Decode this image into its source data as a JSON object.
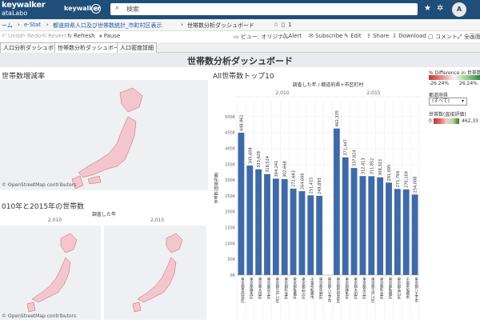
{
  "topnav": {
    "logo_line1": "keywalker",
    "logo_line2": "ataLabo",
    "site_name": "keywalker",
    "search_icon": "search-icon",
    "search_placeholder": "検索",
    "icons": [
      "alert-icon",
      "star-icon",
      "settings-icon"
    ],
    "avatar_initials": "A"
  },
  "breadcrumb": {
    "items": [
      "ーム",
      "e-Stat",
      "都道府県人口及び世帯数統計_市町村区表示",
      "世帯数分析ダッシュボード"
    ],
    "separator": "›",
    "version": "1"
  },
  "toolbar": {
    "left": [
      "Undo",
      "Redo",
      "Revert",
      "Refresh",
      "Pause"
    ],
    "right": [
      "ビュー: オリジナル",
      "Alert",
      "Subscribe",
      "Edit",
      "Share",
      "Download",
      "コメント",
      "全画面"
    ]
  },
  "tabs": [
    "人口分析ダッシュボード",
    "世帯数分析ダッシュボード",
    "人口密度詳細"
  ],
  "dashboard": {
    "title": "世帯数分析ダッシュボード",
    "left_top_title": "世帯数増減率",
    "left_bottom_title": "010年と2015年の世帯数",
    "left_bottom_header": "調査した年",
    "left_bottom_years": [
      "2,010",
      "2,015"
    ],
    "osm_credit": "© OpenStreetMap contributors"
  },
  "legend": {
    "pct_title": "% Difference in 世帯数(直...",
    "pct_min": "-26.24%",
    "pct_max": "26.24%",
    "pref_title": "都道府県",
    "pref_value": "(すべて)",
    "households_title": "世帯数(直接評価)",
    "households_min": "0",
    "households_max": "462,33"
  },
  "chart_data": {
    "type": "bar",
    "title": "All世帯数トップ10",
    "header": "調査した年 / 都道府県+市区町村",
    "groups": [
      "2,010",
      "2,015"
    ],
    "ylabel": "世帯数(直接評価)",
    "ylim": [
      0,
      550000
    ],
    "yticks": [
      0,
      50000,
      100000,
      150000,
      200000,
      250000,
      300000,
      350000,
      400000,
      450000,
      500000
    ],
    "ytick_labels": [
      "0K",
      "50K",
      "100K",
      "150K",
      "200K",
      "250K",
      "300K",
      "350K",
      "400K",
      "450K",
      "500K"
    ],
    "categories": [
      "東京都世田谷区",
      "東京都練馬区",
      "東京都大田区",
      "東京都足立区",
      "東京都江戸川区",
      "東京都杉並区",
      "東京都板橋区",
      "東京都品川区",
      "千葉県船橋市",
      "東京都中野区",
      "東京都八王子市",
      "東京都世田谷区",
      "東京都練馬区",
      "東京都大田区",
      "東京都足立区",
      "東京都江戸川区",
      "東京都杉並区",
      "東京都板橋区",
      "東京都品川区",
      "千葉県船橋市",
      "東京都八王子市"
    ],
    "values": [
      448961,
      345608,
      333628,
      318524,
      304241,
      302668,
      272683,
      264666,
      251415,
      249893,
      null,
      462335,
      371447,
      337824,
      312413,
      311852,
      308323,
      291695,
      271766,
      270169,
      254008
    ],
    "value_labels": [
      "448,961",
      "345,608",
      "333,628",
      "318,524",
      "304,241",
      "302,668",
      "272,683",
      "264,666",
      "251,415",
      "249,893",
      "",
      "462,335",
      "371,447",
      "337,824",
      "312,413",
      "311,852",
      "308,323",
      "291,695",
      "271,766",
      "270,169",
      "254,008"
    ],
    "bar_color": "#3f6aa8"
  }
}
